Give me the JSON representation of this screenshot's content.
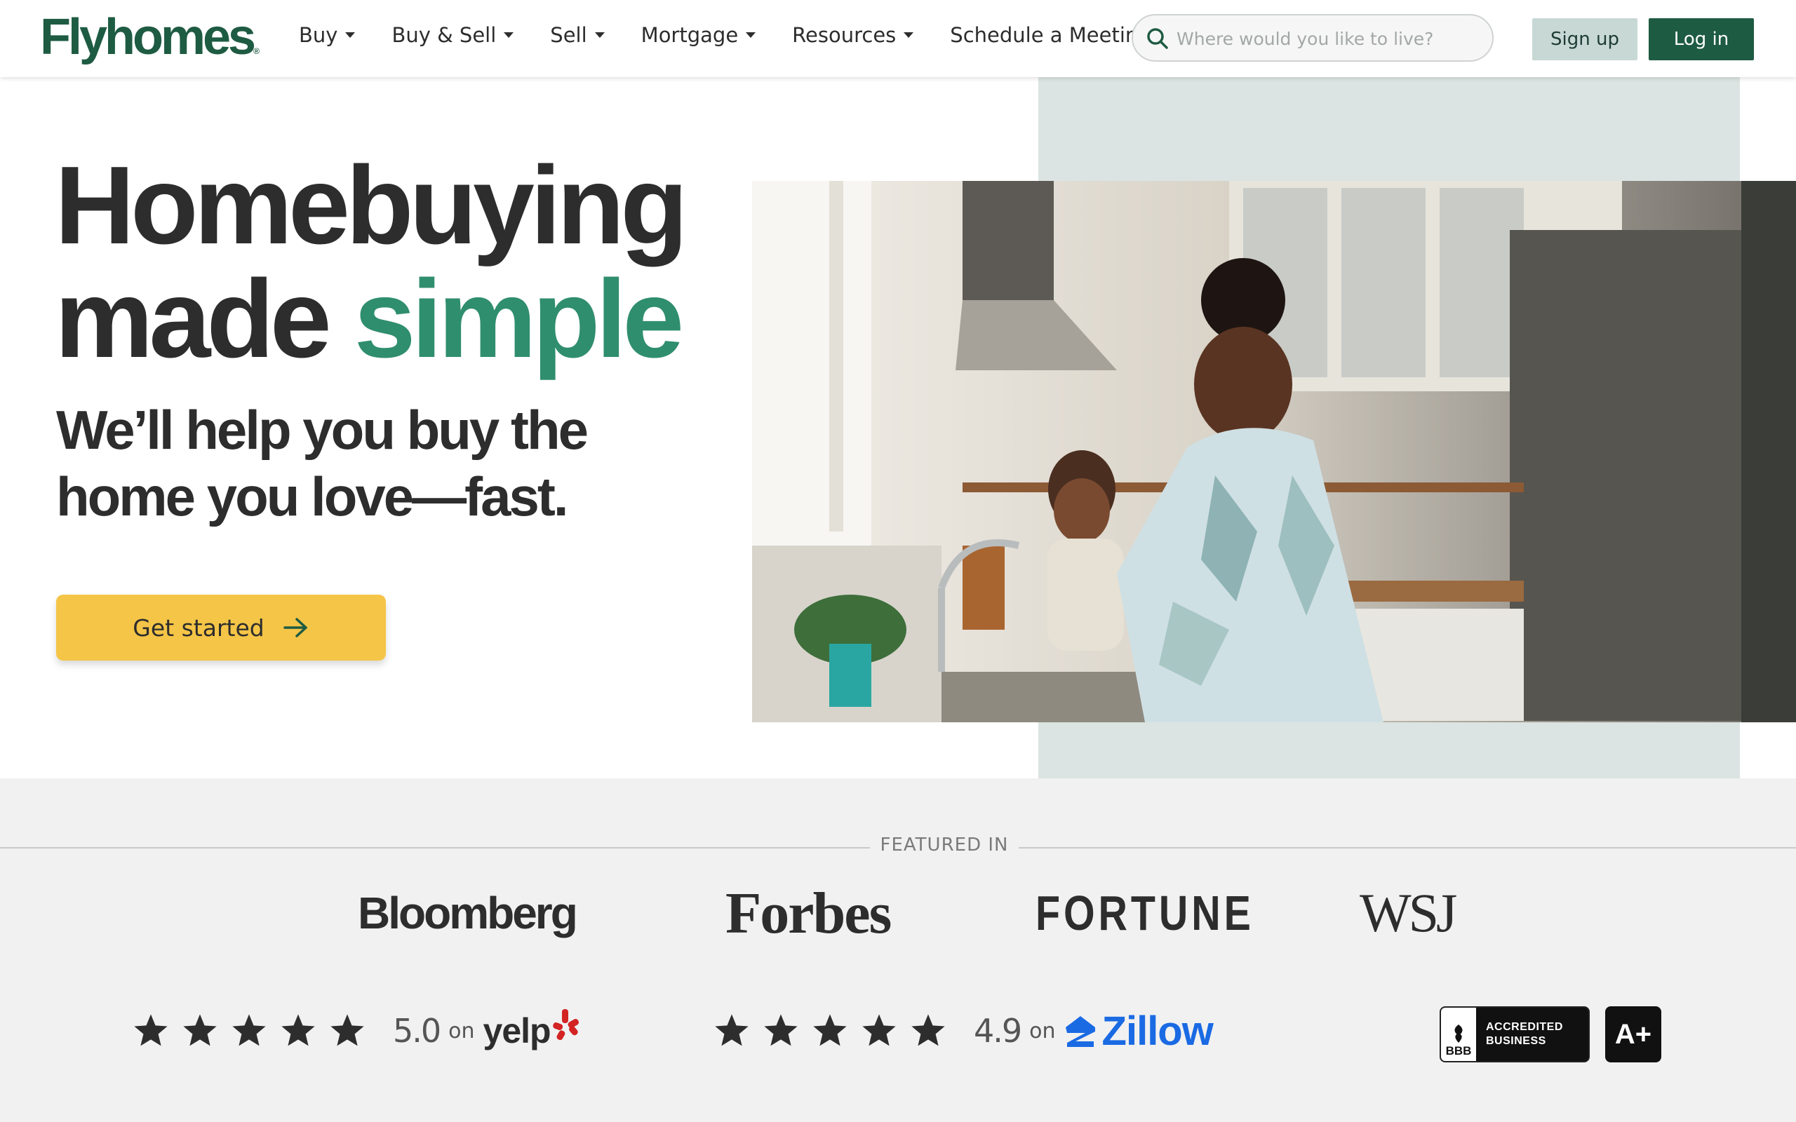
{
  "brand": {
    "logo_text": "Flyhomes",
    "reg_mark": "®",
    "green": "#1e5b43",
    "accent_green": "#2f8e6d",
    "yellow": "#f5c547"
  },
  "nav": {
    "items": [
      {
        "label": "Buy",
        "icon": "caret-down-icon"
      },
      {
        "label": "Buy & Sell",
        "icon": "caret-down-icon"
      },
      {
        "label": "Sell",
        "icon": "caret-down-icon"
      },
      {
        "label": "Mortgage",
        "icon": "caret-down-icon"
      },
      {
        "label": "Resources",
        "icon": "caret-down-icon"
      },
      {
        "label": "Schedule a Meeting",
        "icon": "caret-down-icon"
      }
    ],
    "search": {
      "placeholder": "Where would you like to live?",
      "value": "",
      "icon": "search-icon"
    },
    "signup_label": "Sign up",
    "login_label": "Log in"
  },
  "hero": {
    "title_line1": "Homebuying",
    "title_line2_plain": "made",
    "title_line2_accent": "simple",
    "subtitle_line1": "We’ll help you buy the",
    "subtitle_line2": "home you love—fast.",
    "cta_label": "Get started",
    "cta_icon": "arrow-right-icon",
    "photo_alt": "Mother and child washing hands at a kitchen sink"
  },
  "featured": {
    "label": "FEATURED IN",
    "press": [
      "Bloomberg",
      "Forbes",
      "FORTUNE",
      "WSJ"
    ],
    "ratings": [
      {
        "stars": 5,
        "score": "5.0",
        "on": "on",
        "source": "yelp"
      },
      {
        "stars": 5,
        "score": "4.9",
        "on": "on",
        "source": "Zillow"
      }
    ],
    "bbb": {
      "seal": "BBB",
      "line1": "ACCREDITED",
      "line2": "BUSINESS",
      "grade": "A+"
    }
  }
}
